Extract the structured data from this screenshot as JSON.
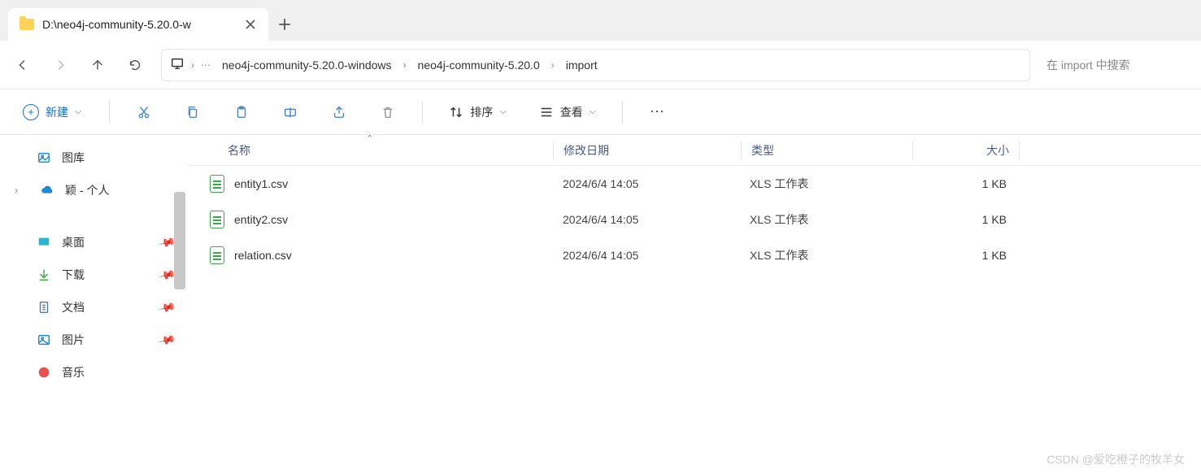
{
  "tab": {
    "title": "D:\\neo4j-community-5.20.0-w"
  },
  "breadcrumb": {
    "items": [
      "neo4j-community-5.20.0-windows",
      "neo4j-community-5.20.0",
      "import"
    ]
  },
  "search": {
    "placeholder": "在 import 中搜索"
  },
  "toolbar": {
    "new_label": "新建",
    "sort_label": "排序",
    "view_label": "查看"
  },
  "sidebar": {
    "gallery": "图库",
    "personal": "颖 - 个人",
    "desktop": "桌面",
    "downloads": "下载",
    "documents": "文档",
    "pictures": "图片",
    "music": "音乐"
  },
  "columns": {
    "name": "名称",
    "date": "修改日期",
    "type": "类型",
    "size": "大小"
  },
  "files": [
    {
      "name": "entity1.csv",
      "date": "2024/6/4 14:05",
      "type": "XLS 工作表",
      "size": "1 KB"
    },
    {
      "name": "entity2.csv",
      "date": "2024/6/4 14:05",
      "type": "XLS 工作表",
      "size": "1 KB"
    },
    {
      "name": "relation.csv",
      "date": "2024/6/4 14:05",
      "type": "XLS 工作表",
      "size": "1 KB"
    }
  ],
  "watermark": "CSDN @爱吃橙子的牧羊女"
}
